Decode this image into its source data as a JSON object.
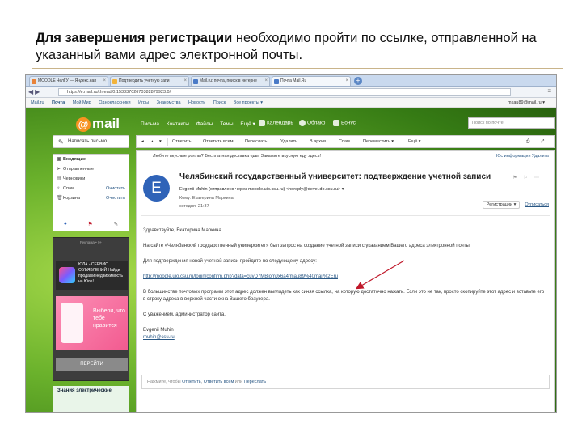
{
  "caption": {
    "bold": "Для завершения регистрации",
    "rest": " необходимо пройти по ссылке, отправленной на указанный вами адрес электронной почты."
  },
  "browser": {
    "tabs": [
      "MOODLE ЧелГУ — Яндекс.нап",
      "Подтвердить учетную запи",
      "Mail.ru: почта, поиск в интерне",
      "Почта Mail.Ru"
    ],
    "active_tab": 3,
    "url": "https://e.mail.ru/thread/0:15383702670382879923:0/"
  },
  "portal": {
    "links": [
      "Mail.ru",
      "Почта",
      "Мой Мир",
      "Одноклассники",
      "Игры",
      "Знакомства",
      "Новости",
      "Поиск",
      "Все проекты ▾"
    ],
    "user": "mkau89@mail.ru ▾"
  },
  "header": {
    "logo": "mail",
    "nav": [
      "Письма",
      "Контакты",
      "Файлы",
      "Темы",
      "Ещё ▾"
    ],
    "services": [
      "Календарь",
      "Облако",
      "Бонус"
    ],
    "search_placeholder": "Поиск по почте"
  },
  "sidebar": {
    "compose": "Написать письмо",
    "folders": [
      {
        "label": "Входящие",
        "bold": true,
        "action": ""
      },
      {
        "label": "Отправленные",
        "bold": false,
        "action": ""
      },
      {
        "label": "Черновики",
        "bold": false,
        "action": ""
      },
      {
        "label": "Спам",
        "bold": false,
        "action": "Очистить"
      },
      {
        "label": "Корзина",
        "bold": false,
        "action": "Очистить"
      }
    ],
    "ad": {
      "label": "Реклама • 0+",
      "card1": "ЮЛА - СЕРВИС ОБЪЯВЛЕНИЙ Найди продажи недвижимость на Юле!",
      "card2": "Выбери, что тебе нравится",
      "button": "ПЕРЕЙТИ"
    },
    "ad2": "Знания электрические"
  },
  "toolbar": {
    "buttons": [
      "Ответить",
      "Ответить всем",
      "Переслать",
      "Удалить",
      "В архив",
      "Спам",
      "Переместить ▾",
      "Ещё ▾"
    ]
  },
  "message": {
    "adline": "Любите вкусные роллы? Бесплатная доставка еды. Закажите вкусную еду здесь!",
    "rlinks": "Юс информация  Удалить",
    "avatar_letter": "E",
    "subject": "Челябинский государственный университет: подтверждение учетной записи",
    "from": "Evgenii Muhin (отправлено через moodle.uio.csu.ru) <noreply@devel.do.csu.ru> ▾",
    "to": "Кому: Екатерина Маркина",
    "date": "сегодня, 21:37",
    "action_register": "Регистрации ▾",
    "action_unsubscribe": "Отписаться",
    "greeting": "Здравствуйте, Екатерина Маркина.",
    "p1": "На сайте «Челябинский государственный университет» был запрос на создание учетной записи с указанием Вашего адреса электронной почты.",
    "p2": "Для подтверждения новой учетной записи пройдите по следующему адресу:",
    "link": "http://moodle.uio.csu.ru/login/confirm.php?data=cuvD7MBjomJx6a4/mau89%40mail%2Eru",
    "p3": "В большинстве почтовых программ этот адрес должен выглядеть как синяя ссылка, на которую достаточно нажать. Если это не так, просто скопируйте этот адрес и вставьте его в строку адреса в верхней части окна Вашего браузера.",
    "regards": "С уважением, администратор сайта,",
    "sig_name": "Evgenii Muhin",
    "sig_mail": "muhin@csu.ru",
    "reply_prefix": "Нажмите, чтобы ",
    "reply_link1": "Ответить",
    "reply_mid": ", ",
    "reply_link2": "Ответить всем",
    "reply_or": " или ",
    "reply_link3": "Переслать"
  },
  "colors": {
    "accent": "#2f63b8",
    "link": "#2a5885",
    "arrow": "#c0182a",
    "mail_orange": "#f79321"
  }
}
